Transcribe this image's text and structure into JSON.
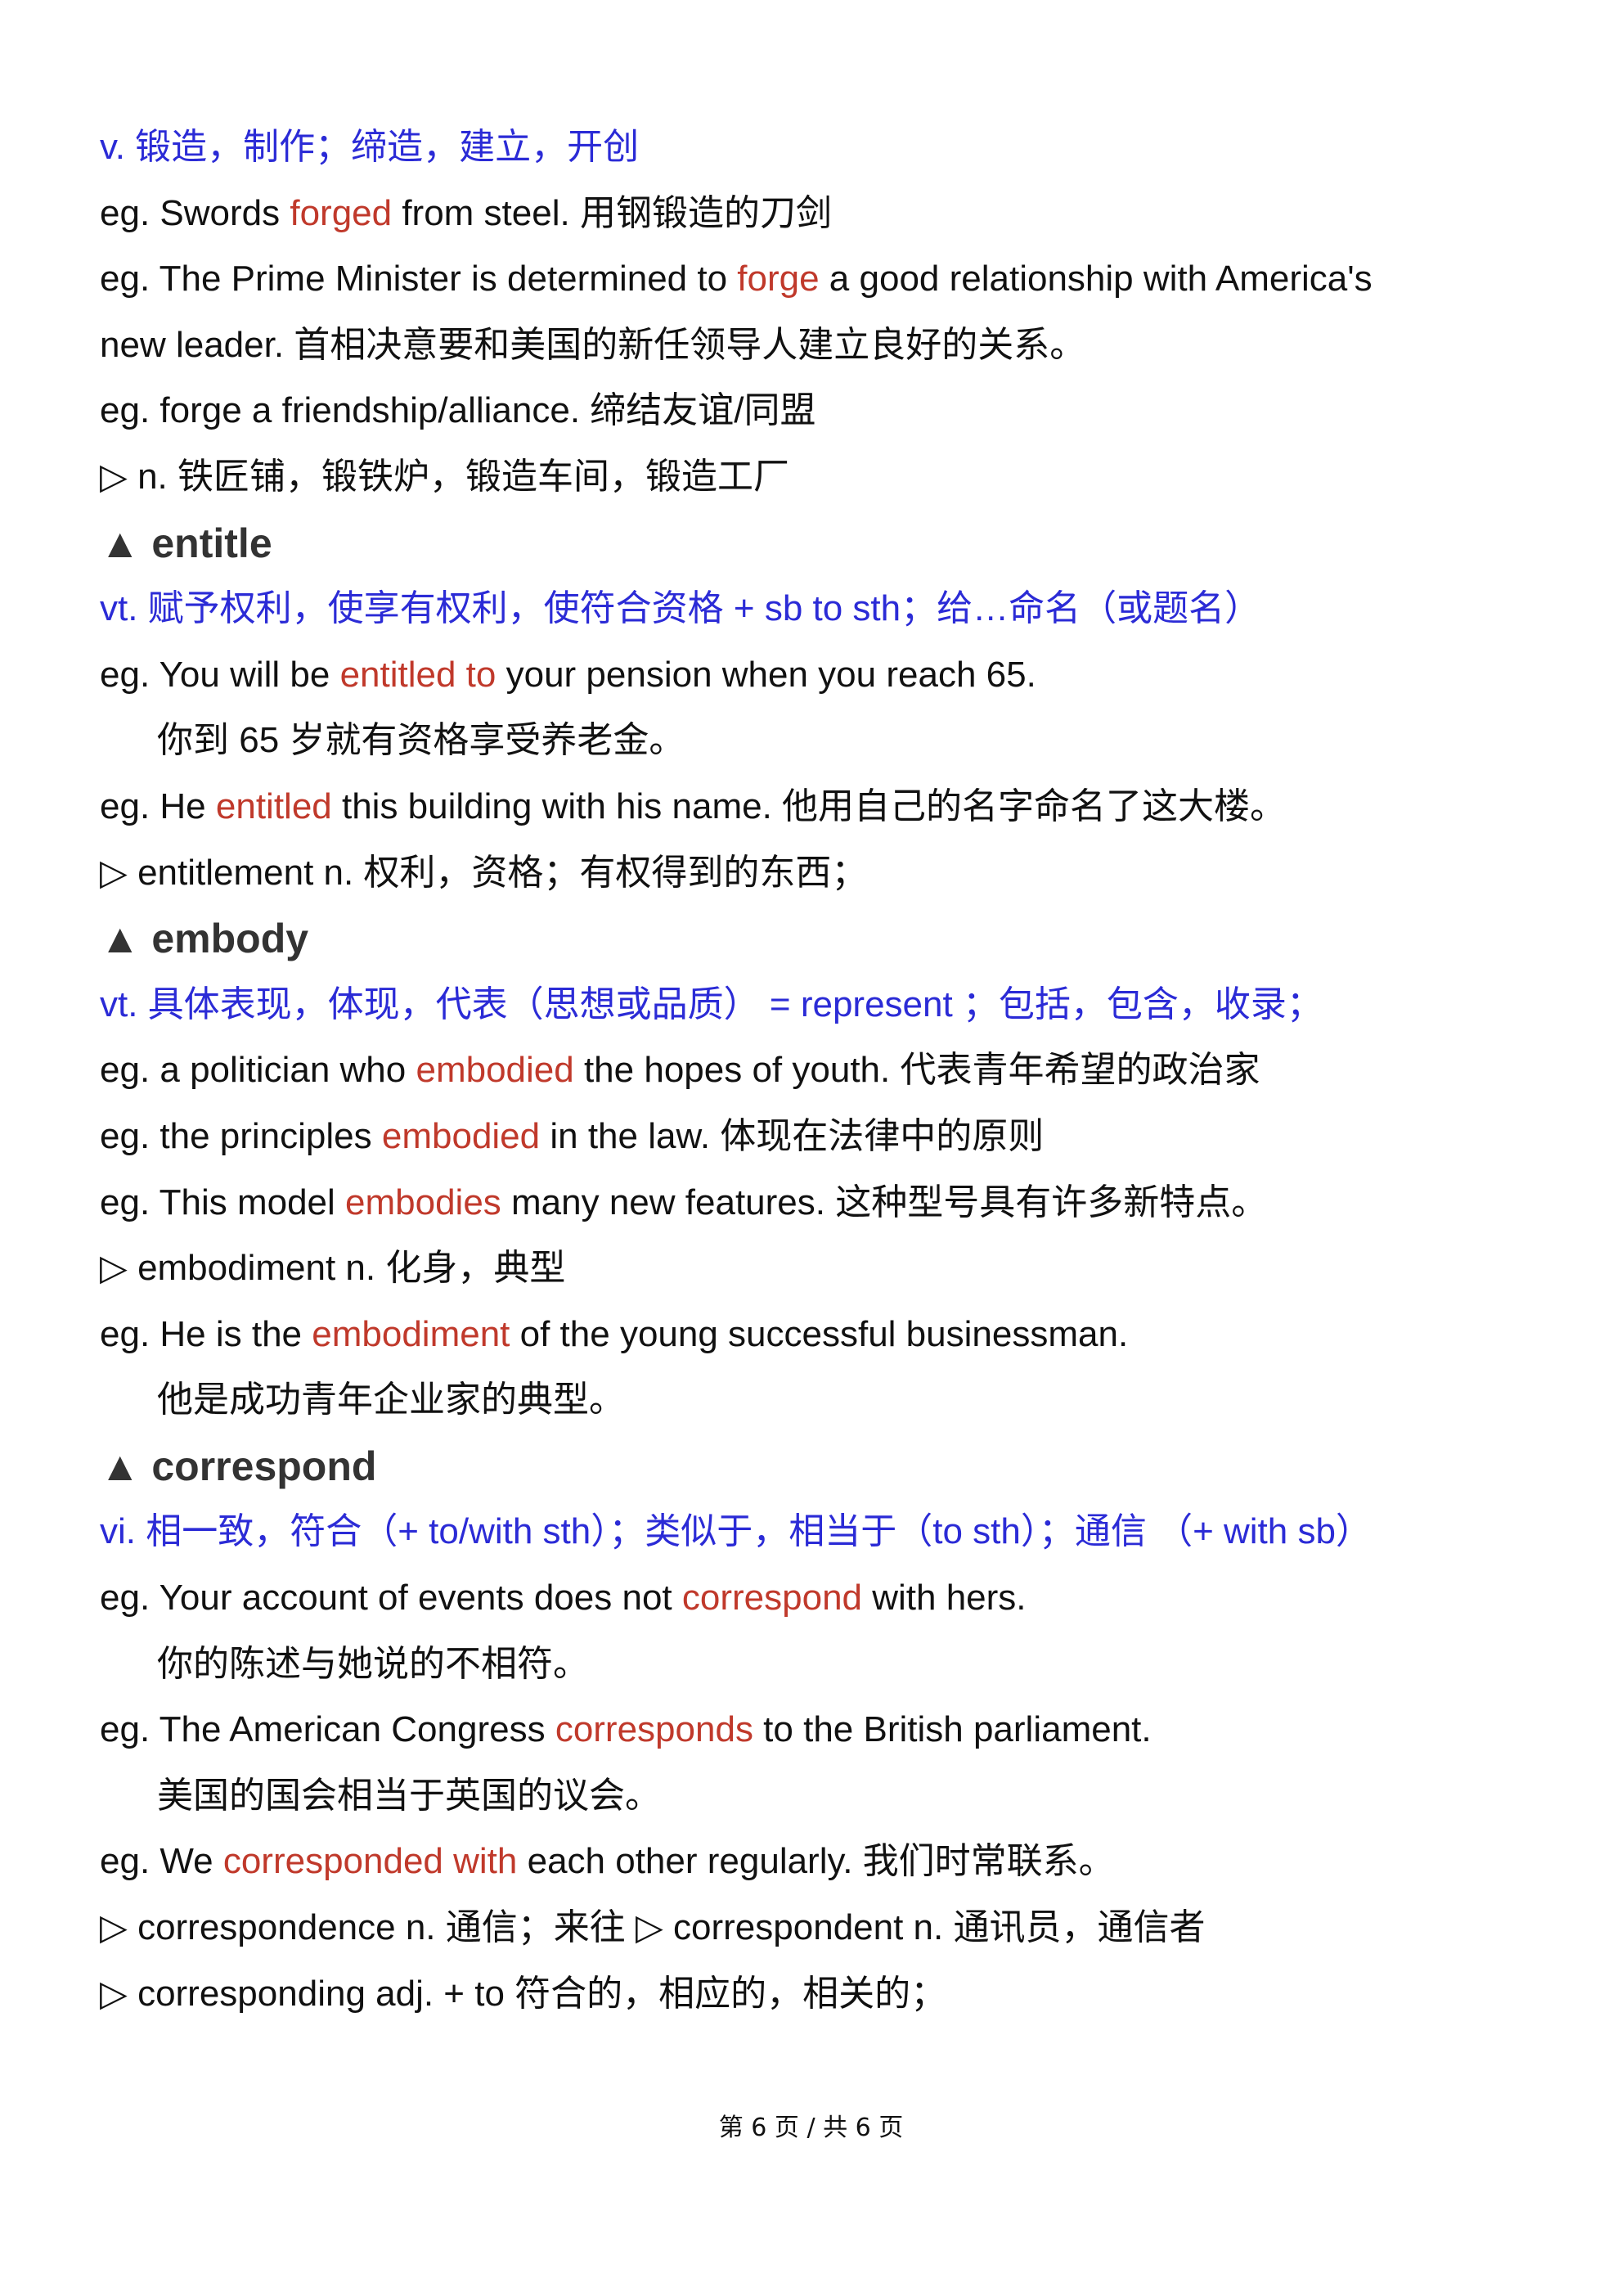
{
  "lines": [
    {
      "cls": "def",
      "segments": [
        {
          "t": "v.  锻造，制作；缔造，建立，开创"
        }
      ]
    },
    {
      "cls": "",
      "segments": [
        {
          "t": "eg. Swords "
        },
        {
          "t": "forged",
          "hl": true
        },
        {
          "t": " from steel.  用钢锻造的刀剑"
        }
      ]
    },
    {
      "cls": "",
      "segments": [
        {
          "t": "eg. The Prime Minister is determined to "
        },
        {
          "t": "forge",
          "hl": true
        },
        {
          "t": " a good relationship with America's"
        }
      ]
    },
    {
      "cls": "",
      "segments": [
        {
          "t": "new leader.  首相决意要和美国的新任领导人建立良好的关系。"
        }
      ]
    },
    {
      "cls": "",
      "segments": [
        {
          "t": "eg. forge a friendship/alliance.  缔结友谊/同盟"
        }
      ]
    },
    {
      "cls": "",
      "segments": [
        {
          "t": "▷ n.  铁匠铺，锻铁炉，锻造车间，锻造工厂"
        }
      ]
    },
    {
      "cls": "head",
      "segments": [
        {
          "t": "▲ entitle"
        }
      ]
    },
    {
      "cls": "def",
      "segments": [
        {
          "t": "vt.  赋予权利，使享有权利，使符合资格  + sb to sth；给…命名（或题名）"
        }
      ]
    },
    {
      "cls": "",
      "segments": [
        {
          "t": "eg. You will be "
        },
        {
          "t": "entitled to",
          "hl": true
        },
        {
          "t": " your pension when you reach 65."
        }
      ]
    },
    {
      "cls": "indent",
      "segments": [
        {
          "t": "你到 65 岁就有资格享受养老金。"
        }
      ]
    },
    {
      "cls": "",
      "segments": [
        {
          "t": "eg. He "
        },
        {
          "t": "entitled",
          "hl": true
        },
        {
          "t": " this building with his name.  他用自己的名字命名了这大楼。"
        }
      ]
    },
    {
      "cls": "",
      "segments": [
        {
          "t": "▷ entitlement n.  权利，资格；有权得到的东西；"
        }
      ]
    },
    {
      "cls": "head",
      "segments": [
        {
          "t": "▲ embody"
        }
      ]
    },
    {
      "cls": "def",
      "segments": [
        {
          "t": "vt.  具体表现，体现，代表（思想或品质） = represent  ；包括，包含，收录；"
        }
      ]
    },
    {
      "cls": "",
      "segments": [
        {
          "t": "eg. a politician who "
        },
        {
          "t": "embodied",
          "hl": true
        },
        {
          "t": " the hopes of youth.  代表青年希望的政治家"
        }
      ]
    },
    {
      "cls": "",
      "segments": [
        {
          "t": "eg. the principles "
        },
        {
          "t": "embodied",
          "hl": true
        },
        {
          "t": " in the law.  体现在法律中的原则"
        }
      ]
    },
    {
      "cls": "",
      "segments": [
        {
          "t": "eg. This model "
        },
        {
          "t": "embodies",
          "hl": true
        },
        {
          "t": " many new features.  这种型号具有许多新特点。"
        }
      ]
    },
    {
      "cls": "",
      "segments": [
        {
          "t": "▷ embodiment n.  化身，典型"
        }
      ]
    },
    {
      "cls": "",
      "segments": [
        {
          "t": "eg. He is the "
        },
        {
          "t": "embodiment",
          "hl": true
        },
        {
          "t": " of the young successful businessman."
        }
      ]
    },
    {
      "cls": "indent",
      "segments": [
        {
          "t": "他是成功青年企业家的典型。"
        }
      ]
    },
    {
      "cls": "head",
      "segments": [
        {
          "t": "▲ correspond"
        }
      ]
    },
    {
      "cls": "def",
      "segments": [
        {
          "t": "vi.  相一致，符合（+ to/with sth）；类似于，相当于（to sth）；通信  （+ with sb）"
        }
      ]
    },
    {
      "cls": "",
      "segments": [
        {
          "t": "eg. Your account of events does not "
        },
        {
          "t": "correspond",
          "hl": true
        },
        {
          "t": " with hers."
        }
      ]
    },
    {
      "cls": "indent",
      "segments": [
        {
          "t": "你的陈述与她说的不相符。"
        }
      ]
    },
    {
      "cls": "",
      "segments": [
        {
          "t": "eg. The American Congress "
        },
        {
          "t": "corresponds",
          "hl": true
        },
        {
          "t": " to the British parliament."
        }
      ]
    },
    {
      "cls": "indent",
      "segments": [
        {
          "t": "美国的国会相当于英国的议会。"
        }
      ]
    },
    {
      "cls": "",
      "segments": [
        {
          "t": "eg. We "
        },
        {
          "t": "corresponded with",
          "hl": true
        },
        {
          "t": " each other regularly. 我们时常联系。"
        }
      ]
    },
    {
      "cls": "",
      "segments": [
        {
          "t": "▷ correspondence n.  通信；来往  ▷ correspondent n.  通讯员，通信者"
        }
      ]
    },
    {
      "cls": "",
      "segments": [
        {
          "t": "▷ corresponding adj. + to  符合的，相应的，相关的；"
        }
      ]
    }
  ],
  "footer": "第 6 页 / 共 6 页",
  "colors": {
    "definition": "#2b2bd6",
    "highlight": "#c0392b",
    "heading": "#333333",
    "text": "#111111"
  }
}
